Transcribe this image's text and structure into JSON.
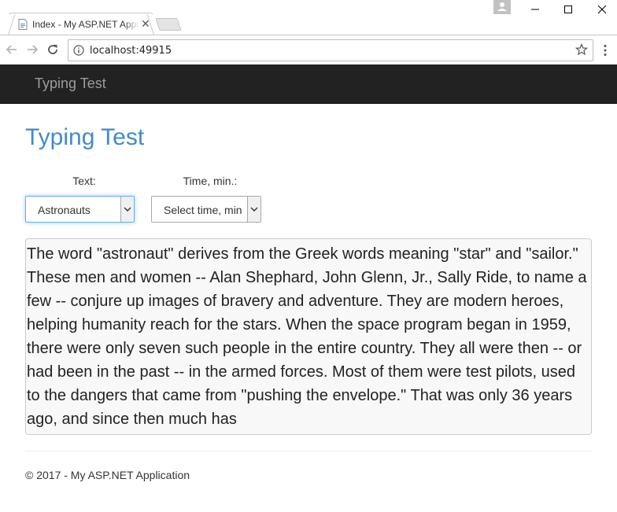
{
  "browser": {
    "tab_title": "Index - My ASP.NET Application",
    "url": "localhost:49915"
  },
  "navbar": {
    "brand": "Typing Test"
  },
  "main": {
    "heading": "Typing Test",
    "text_label": "Text:",
    "text_selected": "Astronauts",
    "time_label": "Time, min.:",
    "time_selected": "Select time, min",
    "passage": "The word \"astronaut\" derives from the Greek words meaning \"star\" and \"sailor.\" These men and women -- Alan Shephard, John Glenn, Jr., Sally Ride, to name a few -- conjure up images of bravery and adventure. They are modern heroes, helping humanity reach for the stars. When the space program began in 1959, there were only seven such people in the entire country. They all were then -- or had been in the past -- in the armed forces. Most of them were test pilots, used to the dangers that came from \"pushing the envelope.\" That was only 36 years ago, and since then much has"
  },
  "footer": {
    "text": "© 2017 - My ASP.NET Application"
  },
  "colors": {
    "navbar": "#222222",
    "heading": "#428bca",
    "focus": "#66afe9"
  }
}
